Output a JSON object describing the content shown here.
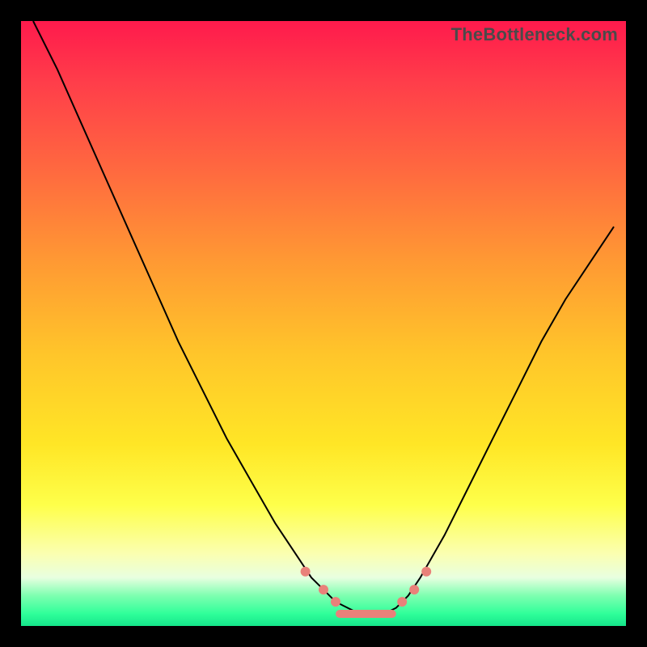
{
  "watermark": "TheBottleneck.com",
  "colors": {
    "frame": "#000000",
    "curve": "#000000",
    "marker": "#e9817a"
  },
  "chart_data": {
    "type": "line",
    "title": "",
    "xlabel": "",
    "ylabel": "",
    "xlim": [
      0,
      100
    ],
    "ylim": [
      0,
      100
    ],
    "note": "Axis values are normalized 0–100 in both directions (no tick labels are shown in the image). y≈0 is the bottom of the colored plot area; y≈100 is the top. The curve is a V/U shape with its trough near x≈55–60 at y≈2, and a flat segment along the bottom between roughly x≈52 and x≈62.",
    "series": [
      {
        "name": "bottleneck-curve",
        "x": [
          2,
          6,
          10,
          14,
          18,
          22,
          26,
          30,
          34,
          38,
          42,
          46,
          48,
          50,
          52,
          54,
          56,
          58,
          60,
          62,
          64,
          66,
          70,
          74,
          78,
          82,
          86,
          90,
          94,
          98
        ],
        "y": [
          100,
          92,
          83,
          74,
          65,
          56,
          47,
          39,
          31,
          24,
          17,
          11,
          8,
          6,
          4,
          3,
          2,
          2,
          2,
          3,
          5,
          8,
          15,
          23,
          31,
          39,
          47,
          54,
          60,
          66
        ]
      }
    ],
    "markers": {
      "note": "Salmon-colored dots and short horizontal pill segments clustered around the curve trough, all near y≈2–7.",
      "points_xy": [
        [
          47,
          9
        ],
        [
          50,
          6
        ],
        [
          52,
          4
        ],
        [
          63,
          4
        ],
        [
          65,
          6
        ],
        [
          67,
          9
        ]
      ],
      "flat_segment_x_range": [
        52,
        62
      ],
      "flat_segment_y": 2
    },
    "background_gradient_stops": [
      {
        "pos": 0.0,
        "color": "#ff1a4c"
      },
      {
        "pos": 0.25,
        "color": "#ff6a3f"
      },
      {
        "pos": 0.55,
        "color": "#ffc52a"
      },
      {
        "pos": 0.8,
        "color": "#feff4a"
      },
      {
        "pos": 0.92,
        "color": "#e8ffe0"
      },
      {
        "pos": 1.0,
        "color": "#15e58a"
      }
    ]
  }
}
